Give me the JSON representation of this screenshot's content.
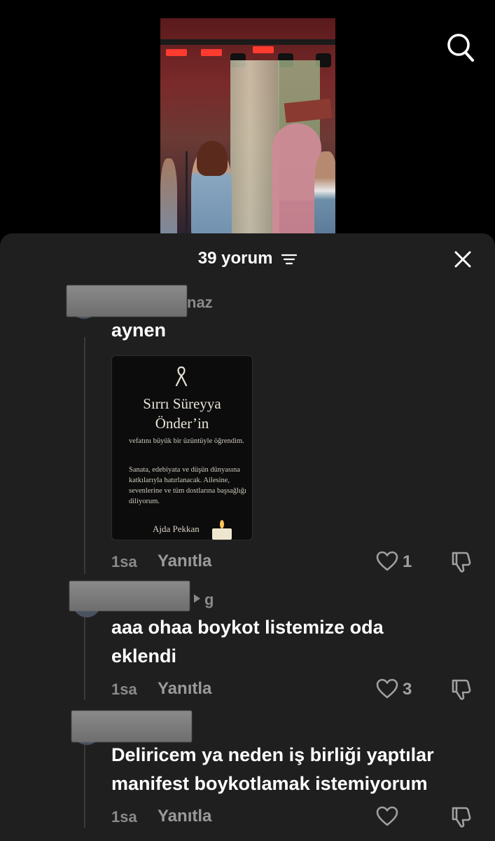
{
  "video": {
    "description_icon": "concert-video-thumbnail"
  },
  "header": {
    "search_icon": "search-icon"
  },
  "sheet": {
    "count_label": "39 yorum",
    "filter_icon": "filter-icon",
    "close_icon": "close-icon"
  },
  "comments": [
    {
      "username_suffix": "naz",
      "text": "aynen",
      "attachment": {
        "title_line1": "Sırrı Süreyya",
        "title_line2": "Önder’in",
        "para1": "vefatını büyük bir üzüntüyle öğrendim.",
        "para2": "Sanata, edebiyata ve düşün dünyasına katkılarıyla hatırlanacak. Ailesine, sevenlerine ve tüm dostlarına başsağlığı diliyorum.",
        "signature": "Ajda Pekkan"
      },
      "time": "1sa",
      "reply": "Yanıtla",
      "likes": "1"
    },
    {
      "username_suffix": "g",
      "text_line1": "aaa ohaa boykot listemize oda",
      "text_line2": "eklendi",
      "time": "1sa",
      "reply": "Yanıtla",
      "likes": "3"
    },
    {
      "text_line1": "Deliricem ya neden iş birliği yaptılar",
      "text_line2": "manifest boykotlamak istemiyorum",
      "time": "1sa",
      "reply": "Yanıtla",
      "likes": ""
    }
  ],
  "colors": {
    "sheet_bg": "#1f1f1f",
    "muted": "#8a8a8a",
    "text": "#ffffff"
  }
}
